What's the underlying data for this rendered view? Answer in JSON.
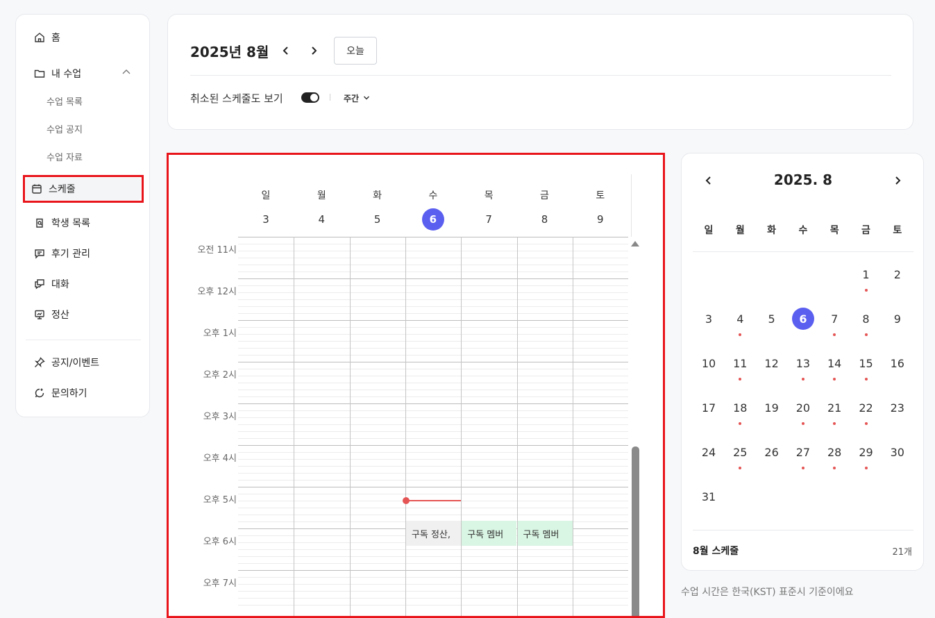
{
  "sidebar": {
    "home": "홈",
    "my_class": "내 수업",
    "class_list": "수업 목록",
    "class_notice": "수업 공지",
    "class_material": "수업 자료",
    "schedule": "스케줄",
    "students": "학생 목록",
    "reviews": "후기 관리",
    "chat": "대화",
    "settlement": "정산",
    "notice_event": "공지/이벤트",
    "inquiry": "문의하기"
  },
  "header": {
    "month_title": "2025년 8월",
    "today_button": "오늘",
    "show_cancelled": "취소된 스케줄도 보기",
    "show_cancelled_on": true,
    "view_mode": "주간"
  },
  "week": {
    "days": [
      {
        "dow": "일",
        "date": "3",
        "today": false
      },
      {
        "dow": "월",
        "date": "4",
        "today": false
      },
      {
        "dow": "화",
        "date": "5",
        "today": false
      },
      {
        "dow": "수",
        "date": "6",
        "today": true
      },
      {
        "dow": "목",
        "date": "7",
        "today": false
      },
      {
        "dow": "금",
        "date": "8",
        "today": false
      },
      {
        "dow": "토",
        "date": "9",
        "today": false
      }
    ],
    "time_labels": [
      "오전 11시",
      "오후 12시",
      "오후 1시",
      "오후 2시",
      "오후 3시",
      "오후 4시",
      "오후 5시",
      "오후 6시",
      "오후 7시"
    ],
    "events": [
      {
        "day_index": 3,
        "label": "구독 정산,",
        "bg": "#f0f0f0"
      },
      {
        "day_index": 4,
        "label": "구독 멤버",
        "bg": "#d9f5e3"
      },
      {
        "day_index": 5,
        "label": "구독 멤버",
        "bg": "#d9f5e3"
      }
    ],
    "now_marker_day_index": 3
  },
  "mini_calendar": {
    "title": "2025. 8",
    "weekdays": [
      "일",
      "월",
      "화",
      "수",
      "목",
      "금",
      "토"
    ],
    "first_weekday_index": 5,
    "days_in_month": 31,
    "today": 6,
    "dot_days": [
      1,
      4,
      7,
      8,
      11,
      13,
      14,
      15,
      18,
      20,
      21,
      22,
      25,
      27,
      28,
      29
    ],
    "schedule_label": "8월 스케줄",
    "schedule_count": "21개"
  },
  "timezone_note": "수업 시간은 한국(KST) 표준시 기준이에요",
  "colors": {
    "accent": "#5b5ff0",
    "highlight_border": "#e8141a",
    "dot": "#e55454",
    "event_green": "#d9f5e3",
    "event_gray": "#f0f0f0"
  }
}
